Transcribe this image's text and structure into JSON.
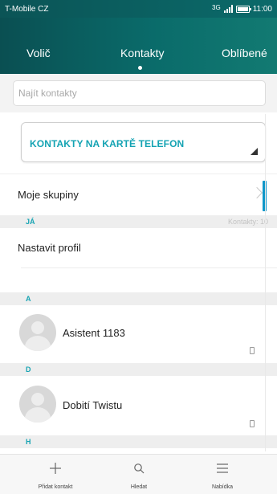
{
  "status_bar": {
    "carrier": "T-Mobile CZ",
    "network": "3G",
    "time": "11:00"
  },
  "tabs": {
    "left": "Volič",
    "center": "Kontakty",
    "right": "Oblíbené"
  },
  "search": {
    "placeholder": "Najít kontakty"
  },
  "phone_contacts_card": {
    "label": "KONTAKTY NA KARTĚ TELEFON"
  },
  "groups_row": {
    "label": "Moje skupiny"
  },
  "sections": [
    {
      "letter": "JÁ",
      "count_label": "Kontakty: 10"
    },
    {
      "letter": "A"
    },
    {
      "letter": "D"
    },
    {
      "letter": "H"
    }
  ],
  "profile_row": {
    "label": "Nastavit profil"
  },
  "contacts": [
    {
      "name": "Asistent 1183"
    },
    {
      "name": "Dobití Twistu"
    }
  ],
  "bottom_bar": {
    "add": "Přidat kontakt",
    "search": "Hledat",
    "menu": "Nabídka"
  },
  "colors": {
    "header_teal": "#0a6b6a",
    "accent_cyan": "#14a3b3",
    "scroll_accent": "#0f97c9"
  }
}
